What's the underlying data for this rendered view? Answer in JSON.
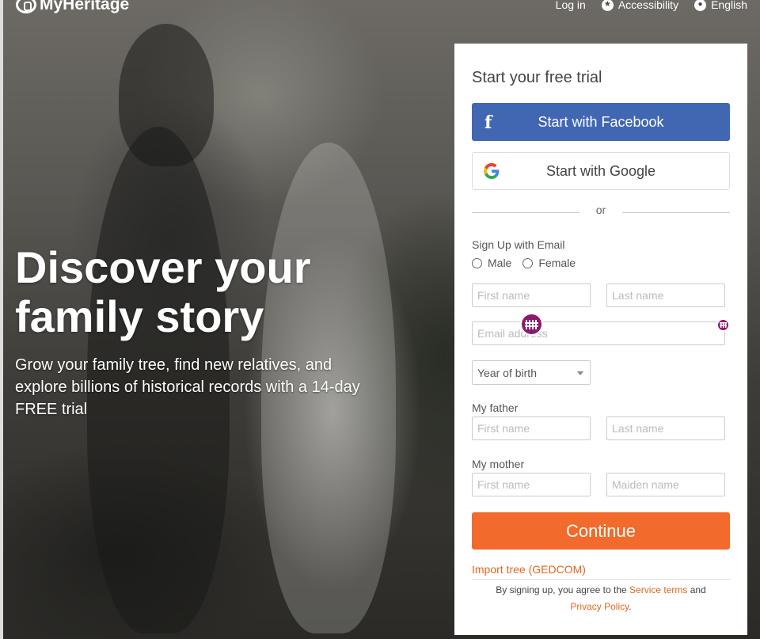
{
  "header": {
    "logo_text": "MyHeritage",
    "links": [
      {
        "label": "Log in",
        "icon": ""
      },
      {
        "label": "Accessibility",
        "icon": "accessibility-icon"
      },
      {
        "label": "English",
        "icon": "globe-icon"
      }
    ]
  },
  "hero": {
    "title_line1": "Discover your",
    "title_line2": "family story",
    "subtitle": "Grow your family tree, find new relatives, and explore billions of historical records with a 14-day FREE trial"
  },
  "signup": {
    "title": "Start your free trial",
    "facebook_label": "Start with Facebook",
    "google_label": "Start with Google",
    "or_text": "or",
    "email_section_label": "Sign Up with Email",
    "gender": {
      "male": "Male",
      "female": "Female"
    },
    "first_name_placeholder": "First name",
    "last_name_placeholder": "Last name",
    "email_placeholder": "Email address",
    "year_of_birth": "Year of birth",
    "father_label": "My father",
    "father_first_placeholder": "First name",
    "father_last_placeholder": "Last name",
    "mother_label": "My mother",
    "mother_first_placeholder": "First name",
    "mother_maiden_placeholder": "Maiden name",
    "continue_label": "Continue",
    "import_link": "Import tree (GEDCOM)",
    "terms_prefix": "By signing up, you agree to the",
    "terms_link": "Service terms",
    "terms_and": "and",
    "privacy_link": "Privacy Policy",
    "terms_suffix": "."
  },
  "colors": {
    "facebook": "#4267b2",
    "continue": "#f26a2c",
    "link": "#e2661f",
    "overlay_badge": "#8b1a6b"
  }
}
